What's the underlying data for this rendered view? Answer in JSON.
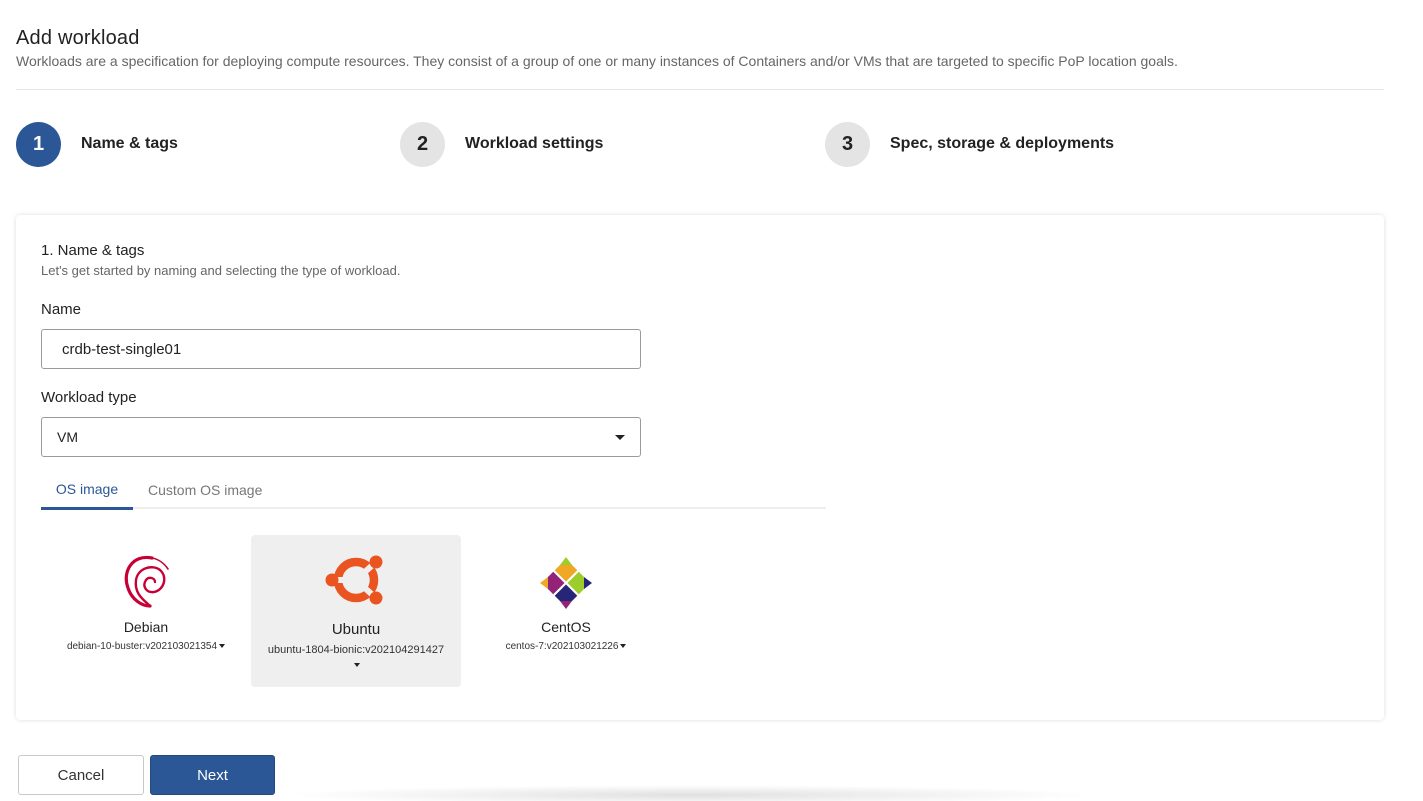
{
  "page": {
    "title": "Add workload",
    "description": "Workloads are a specification for deploying compute resources. They consist of a group of one or many instances of Containers and/or VMs that are targeted to specific PoP location goals."
  },
  "steps": [
    {
      "number": "1",
      "label": "Name & tags",
      "state": "active"
    },
    {
      "number": "2",
      "label": "Workload settings",
      "state": "inactive"
    },
    {
      "number": "3",
      "label": "Spec, storage & deployments",
      "state": "inactive"
    }
  ],
  "form": {
    "section_title": "1. Name & tags",
    "section_description": "Let's get started by naming and selecting the type of workload.",
    "name_label": "Name",
    "name_value": "crdb-test-single01",
    "workload_type_label": "Workload type",
    "workload_type_value": "VM",
    "tabs": [
      {
        "label": "OS image",
        "active": true
      },
      {
        "label": "Custom OS image",
        "active": false
      }
    ],
    "os_images": [
      {
        "name": "Debian",
        "version": "debian-10-buster:v202103021354",
        "icon": "debian-swirl-icon",
        "selected": false
      },
      {
        "name": "Ubuntu",
        "version": "ubuntu-1804-bionic:v202104291427",
        "icon": "ubuntu-circle-of-friends-icon",
        "selected": true
      },
      {
        "name": "CentOS",
        "version": "centos-7:v202103021226",
        "icon": "centos-pinwheel-icon",
        "selected": false
      }
    ]
  },
  "actions": {
    "cancel_label": "Cancel",
    "next_label": "Next"
  },
  "colors": {
    "primary": "#2b5797",
    "debian": "#c70036",
    "ubuntu": "#e95420",
    "step_inactive_bg": "#e4e4e4"
  }
}
